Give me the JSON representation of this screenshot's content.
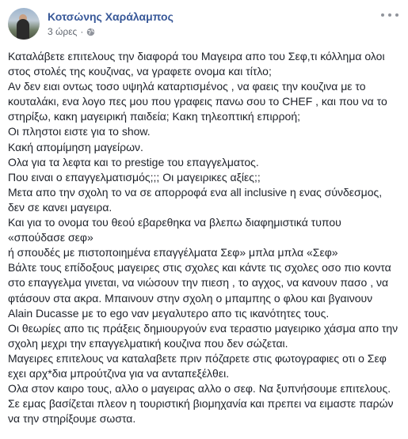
{
  "post": {
    "author": "Κοτσώνης Χαράλαμπος",
    "time": "3 ώρες",
    "separator": "·",
    "privacy_icon": "globe-icon",
    "more_icon": "more-options-icon",
    "link_color": "#385898",
    "meta_color": "#616770",
    "lines": [
      "Καταλάβετε επιτελους την διαφορά του Μαγειρα απο του Σεφ,τι κόλλημα ολοι στος στολές της κουζινας, να γραφετε ονομα και τίτλο;",
      "Αν δεν ειαι οντως τοσο υψηλά καταρτισμένος , να φαεις την κουζινα με το κουταλάκι, ενα λογο πες μου που γραφεις πανω σου το CHEF , και που να το στηρίξω, κακη μαγειρική παιδεία; Κακη τηλεοπτική επιρροή;",
      "Οι πληστοι ειστε για το show.",
      "Κακή απομίμηση μαγείρων.",
      "Ολα για τα λεφτα και το prestige του επαγγελματος.",
      "Που ειναι ο επαγγελματισμός;;; Οι μαγειρικες αξίες;;",
      "Μετα απο την σχολη το να σε απορροφά ενα all inclusive η ενας σύνδεσμος, δεν σε κανει μαγειρα.",
      "Και για το ονομα του θεού εβαρεθηκα να βλεπω διαφημιστικά τυπου «σπούδασε σεφ»",
      "ή σπουδές με πιστοποιημένα επαγγέλματα Σεφ» μπλα μπλα «Σεφ»",
      "Βάλτε τους επίδοξους μαγειρες στις σχολες και κάντε τις σχολες οσο πιο κοντα στο επαγγελμα γινεται, να νιώσουν την πιεση , το αγχος, να κανουν πασο , να φτάσουν στα ακρα. Μπαινουν στην σχολη ο μπαμπης ο φλου και βγαινουν Alain Ducasse με το ego ναν μεγαλυτερο απο τις ικανότητες τους.",
      "Οι θεωρίες απο τις πράξεις δημιουργούν ενα τεραστιο μαγειρικο χάσμα απο την σχολη μεχρι την επαγγελματική κουζινα που δεν σώζεται.",
      "Μαγειρες επιτελους να καταλαβετε πριν πόζαρετε στις φωτογραφιες οτι ο Σεφ εχει αρχ*δια μπρούτζινα για να ανταπεξέλθει.",
      "Ολα στον καιρο τους, αλλο ο μαγειρας αλλο ο σεφ. Να ξυπνήσουμε επιτελους.",
      "Σε εμας βασίζεται πλεον η τουριστική βιομηχανία και πρεπει να ειμαστε παρών να την στηρίξουμε σωστα."
    ]
  }
}
